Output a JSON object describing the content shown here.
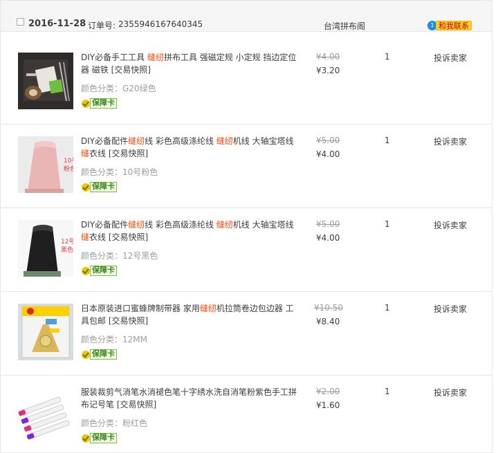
{
  "order": {
    "date": "2016-11-28",
    "order_label": "订单号:",
    "order_number": "2355946167640345",
    "shop": "台湾拼布阁",
    "contact_label": "和我联系",
    "contact_icon_text": "1"
  },
  "items": [
    {
      "title_parts": [
        "DIY必备手工工具 ",
        "缝纫",
        "拼布工具 强磁定规 小定规 挡边定位器 磁铁 [交易快照]"
      ],
      "variant": "颜色分类：G20绿色",
      "badge": "保障卡",
      "original_price": "¥4.00",
      "price": "¥3.20",
      "qty": "1",
      "action": "投诉卖家",
      "thumb_label": ""
    },
    {
      "title_parts": [
        "DIY必备配件",
        "缝纫",
        "线 彩色高级涤纶线 ",
        "缝纫",
        "机线 大轴宝塔线 ",
        "缝",
        "衣线 [交易快照]"
      ],
      "variant": "颜色分类：10号粉色",
      "badge": "保障卡",
      "original_price": "¥5.00",
      "price": "¥4.00",
      "qty": "1",
      "action": "投诉卖家",
      "thumb_label": "10号粉色"
    },
    {
      "title_parts": [
        "DIY必备配件",
        "缝纫",
        "线 彩色高级涤纶线 ",
        "缝纫",
        "机线 大轴宝塔线 ",
        "缝",
        "衣线 [交易快照]"
      ],
      "variant": "颜色分类：12号黑色",
      "badge": "保障卡",
      "original_price": "¥5.00",
      "price": "¥4.00",
      "qty": "1",
      "action": "投诉卖家",
      "thumb_label": "12号黑色"
    },
    {
      "title_parts": [
        "日本原装进口蜜蜂牌制带器 家用",
        "缝纫",
        "机拉筒卷边包边器 工具包邮 [交易快照]"
      ],
      "variant": "颜色分类：12MM",
      "badge": "保障卡",
      "original_price": "¥10.50",
      "price": "¥8.40",
      "qty": "1",
      "action": "投诉卖家",
      "thumb_label": ""
    },
    {
      "title_parts": [
        "服装裁剪气消笔水消褪色笔十字绣水洗自消笔粉紫色手工拼布记号笔 [交易快照]"
      ],
      "variant": "颜色分类：粉红色",
      "badge": "保障卡",
      "original_price": "¥2.00",
      "price": "¥1.60",
      "qty": "1",
      "action": "投诉卖家",
      "thumb_label": ""
    }
  ]
}
